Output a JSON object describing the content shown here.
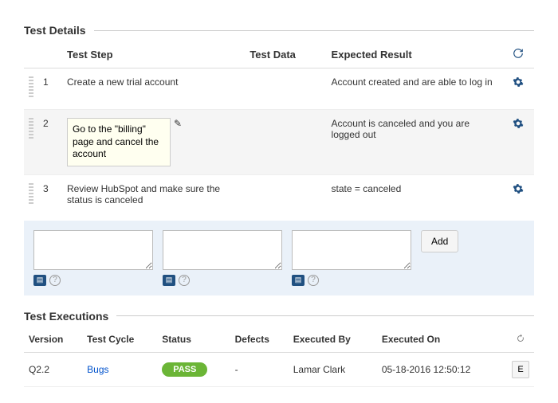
{
  "details": {
    "title": "Test Details",
    "columns": {
      "step": "Test Step",
      "data": "Test Data",
      "result": "Expected Result"
    },
    "rows": [
      {
        "num": "1",
        "step": "Create a new trial account",
        "data": "",
        "result": "Account created and are able to log in"
      },
      {
        "num": "2",
        "step": "Go to the \"billing\" page and cancel the account",
        "data": "",
        "result": "Account is canceled and you are logged out"
      },
      {
        "num": "3",
        "step": "Review HubSpot and make sure the status is canceled",
        "data": "",
        "result": "state = canceled"
      }
    ],
    "add_label": "Add"
  },
  "executions": {
    "title": "Test Executions",
    "columns": {
      "version": "Version",
      "cycle": "Test Cycle",
      "status": "Status",
      "defects": "Defects",
      "by": "Executed By",
      "on": "Executed On"
    },
    "rows": [
      {
        "version": "Q2.2",
        "cycle": "Bugs",
        "status": "PASS",
        "defects": "-",
        "by": "Lamar Clark",
        "on": "05-18-2016 12:50:12",
        "action": "E"
      }
    ]
  }
}
